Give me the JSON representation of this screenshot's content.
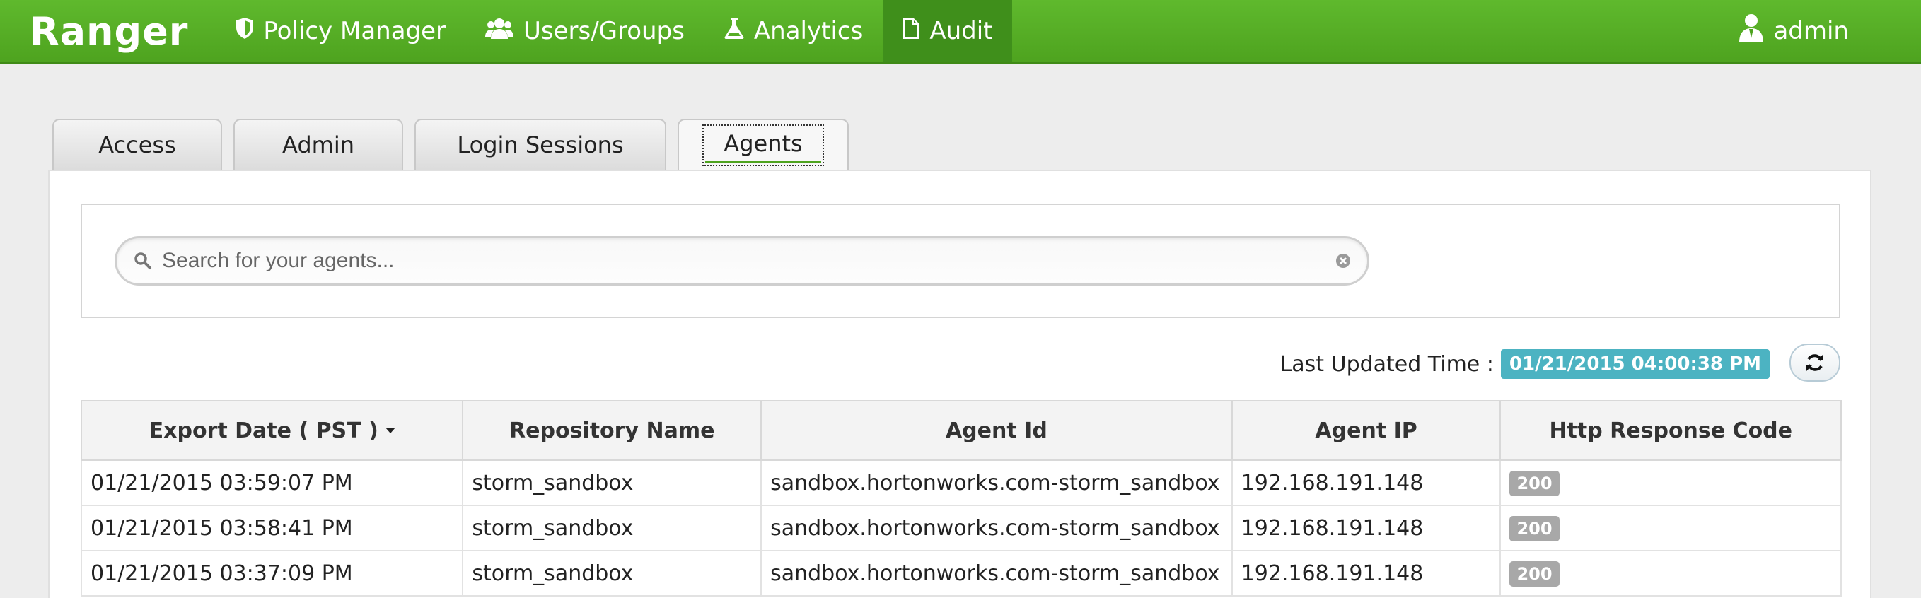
{
  "navbar": {
    "brand": "Ranger",
    "items": [
      {
        "label": "Policy Manager",
        "icon": "shield-icon"
      },
      {
        "label": "Users/Groups",
        "icon": "users-icon"
      },
      {
        "label": "Analytics",
        "icon": "flask-icon"
      },
      {
        "label": "Audit",
        "icon": "file-icon",
        "active": true
      }
    ],
    "user": {
      "label": "admin",
      "icon": "user-icon"
    }
  },
  "tabs": [
    {
      "label": "Access"
    },
    {
      "label": "Admin"
    },
    {
      "label": "Login Sessions"
    },
    {
      "label": "Agents",
      "active": true
    }
  ],
  "search": {
    "placeholder": "Search for your agents...",
    "value": ""
  },
  "status": {
    "label": "Last Updated Time :",
    "time": "01/21/2015 04:00:38 PM"
  },
  "table": {
    "columns": [
      "Export Date ( PST )",
      "Repository Name",
      "Agent Id",
      "Agent IP",
      "Http Response Code"
    ],
    "rows": [
      [
        "01/21/2015 03:59:07 PM",
        "storm_sandbox",
        "sandbox.hortonworks.com-storm_sandbox",
        "192.168.191.148",
        "200"
      ],
      [
        "01/21/2015 03:58:41 PM",
        "storm_sandbox",
        "sandbox.hortonworks.com-storm_sandbox",
        "192.168.191.148",
        "200"
      ],
      [
        "01/21/2015 03:37:09 PM",
        "storm_sandbox",
        "sandbox.hortonworks.com-storm_sandbox",
        "192.168.191.148",
        "200"
      ]
    ]
  },
  "colors": {
    "navbar": "#4ea31f",
    "navbar_active": "#3f8f1b",
    "time_badge": "#4cb3c2",
    "code_badge": "#a8a8a8"
  }
}
